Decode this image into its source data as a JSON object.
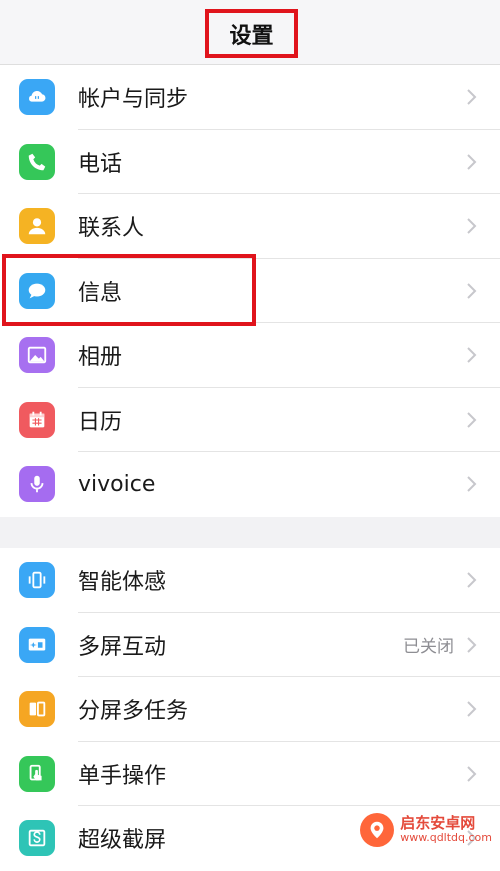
{
  "header": {
    "title": "设置"
  },
  "group1": [
    {
      "label": "帐户与同步",
      "icon": "cloud-sync-icon",
      "color": "#3aa7f5"
    },
    {
      "label": "电话",
      "icon": "phone-icon",
      "color": "#35c759"
    },
    {
      "label": "联系人",
      "icon": "contact-person-icon",
      "color": "#f5b323"
    },
    {
      "label": "信息",
      "icon": "message-bubble-icon",
      "color": "#35a8f0"
    },
    {
      "label": "相册",
      "icon": "photo-album-icon",
      "color": "#a770f0"
    },
    {
      "label": "日历",
      "icon": "calendar-icon",
      "color": "#f05a5f"
    },
    {
      "label": "vivoice",
      "icon": "microphone-icon",
      "color": "#a56cf0"
    }
  ],
  "group2": [
    {
      "label": "智能体感",
      "icon": "motion-sense-icon",
      "color": "#3aa7f5"
    },
    {
      "label": "多屏互动",
      "icon": "screen-cast-icon",
      "color": "#3aa7f5",
      "value": "已关闭"
    },
    {
      "label": "分屏多任务",
      "icon": "split-screen-icon",
      "color": "#f5a623"
    },
    {
      "label": "单手操作",
      "icon": "one-hand-icon",
      "color": "#35c759"
    },
    {
      "label": "超级截屏",
      "icon": "screenshot-icon",
      "color": "#2ec4b6"
    }
  ],
  "watermark": {
    "name": "启东安卓网",
    "url": "www.qdltdq.com"
  }
}
